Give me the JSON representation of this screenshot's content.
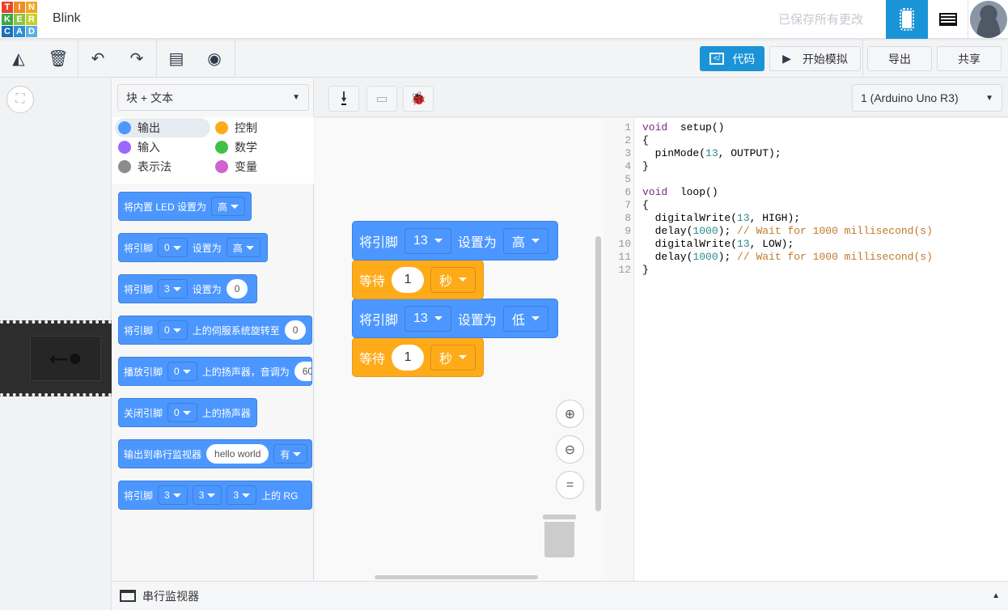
{
  "header": {
    "logo_letters": [
      "T",
      "I",
      "N",
      "K",
      "E",
      "R",
      "C",
      "A",
      "D"
    ],
    "title": "Blink",
    "saved_status": "已保存所有更改"
  },
  "toolbar": {
    "code_label": "代码",
    "simulate_label": "开始模拟",
    "export_label": "导出",
    "share_label": "共享"
  },
  "palette": {
    "mode": "块 + 文本",
    "categories": [
      {
        "label": "输出",
        "color": "#4c97ff"
      },
      {
        "label": "控制",
        "color": "#ffab19"
      },
      {
        "label": "输入",
        "color": "#9966ff"
      },
      {
        "label": "数学",
        "color": "#40bf4a"
      },
      {
        "label": "表示法",
        "color": "#8c8c8c"
      },
      {
        "label": "变量",
        "color": "#cf63cf"
      }
    ],
    "blocks": [
      {
        "parts": [
          "将内置 LED 设置为",
          {
            "dd": "高"
          }
        ]
      },
      {
        "parts": [
          "将引脚",
          {
            "dd": "0"
          },
          "设置为",
          {
            "dd": "高"
          }
        ]
      },
      {
        "parts": [
          "将引脚",
          {
            "dd": "3"
          },
          "设置为",
          {
            "num": "0"
          }
        ]
      },
      {
        "parts": [
          "将引脚",
          {
            "dd": "0"
          },
          "上的伺服系统旋转至",
          {
            "num": "0"
          }
        ]
      },
      {
        "parts": [
          "播放引脚",
          {
            "dd": "0"
          },
          "上的扬声器，音调为",
          {
            "num": "60"
          }
        ]
      },
      {
        "parts": [
          "关闭引脚",
          {
            "dd": "0"
          },
          "上的扬声器"
        ]
      },
      {
        "parts": [
          "输出到串行监视器",
          {
            "num": "hello world"
          },
          {
            "dd": "有"
          }
        ]
      },
      {
        "parts": [
          "将引脚",
          {
            "dd": "3"
          },
          {
            "dd": "3"
          },
          {
            "dd": "3"
          },
          "上的 RG"
        ]
      }
    ]
  },
  "workspace": {
    "blocks": [
      {
        "color": "blue",
        "label": "将引脚",
        "pin": "13",
        "label2": "设置为",
        "value": "高"
      },
      {
        "color": "orange",
        "label": "等待",
        "num": "1",
        "unit": "秒"
      },
      {
        "color": "blue",
        "label": "将引脚",
        "pin": "13",
        "label2": "设置为",
        "value": "低"
      },
      {
        "color": "orange",
        "label": "等待",
        "num": "1",
        "unit": "秒"
      }
    ]
  },
  "device": {
    "selected": "1 (Arduino Uno R3)"
  },
  "code": [
    [
      [
        "kw",
        "void"
      ],
      [
        "",
        "  setup()"
      ]
    ],
    [
      [
        "",
        "{"
      ]
    ],
    [
      [
        "",
        "  pinMode("
      ],
      [
        "nm",
        "13"
      ],
      [
        "",
        ", OUTPUT);"
      ]
    ],
    [
      [
        "",
        "}"
      ]
    ],
    [
      [
        "",
        ""
      ]
    ],
    [
      [
        "kw",
        "void"
      ],
      [
        "",
        "  loop()"
      ]
    ],
    [
      [
        "",
        "{"
      ]
    ],
    [
      [
        "",
        "  digitalWrite("
      ],
      [
        "nm",
        "13"
      ],
      [
        "",
        ", HIGH);"
      ]
    ],
    [
      [
        "",
        "  delay("
      ],
      [
        "nm",
        "1000"
      ],
      [
        "",
        "); "
      ],
      [
        "cm",
        "// Wait for 1000 millisecond(s)"
      ]
    ],
    [
      [
        "",
        "  digitalWrite("
      ],
      [
        "nm",
        "13"
      ],
      [
        "",
        ", LOW);"
      ]
    ],
    [
      [
        "",
        "  delay("
      ],
      [
        "nm",
        "1000"
      ],
      [
        "",
        "); "
      ],
      [
        "cm",
        "// Wait for 1000 millisecond(s)"
      ]
    ],
    [
      [
        "",
        "}"
      ]
    ]
  ],
  "serial": {
    "label": "串行监视器"
  },
  "colors": {
    "accent": "#1a94d6",
    "block_blue": "#4c97ff",
    "block_orange": "#ffab19"
  }
}
